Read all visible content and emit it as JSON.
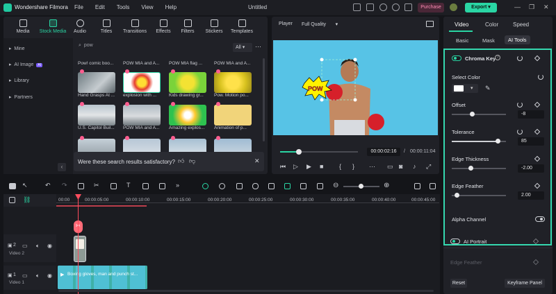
{
  "titlebar": {
    "app_name": "Wondershare Filmora",
    "menu": [
      "File",
      "Edit",
      "Tools",
      "View",
      "Help"
    ],
    "document_title": "Untitled",
    "purchase_label": "Purchase",
    "export_label": "Export"
  },
  "media": {
    "tabs": [
      "Media",
      "Stock Media",
      "Audio",
      "Titles",
      "Transitions",
      "Effects",
      "Filters",
      "Stickers",
      "Templates"
    ],
    "active_tab": "Stock Media",
    "sidebar": [
      "Mine",
      "AI Image",
      "Library",
      "Partners"
    ],
    "ai_badge": "AI",
    "search_value": "pow",
    "filter_value": "All",
    "thumbnails": [
      {
        "caption": "Hand Grasps At ..."
      },
      {
        "caption": "explosion with ..."
      },
      {
        "caption": "Kids drawing gr..."
      },
      {
        "caption": "Pow. Motion po..."
      },
      {
        "caption": "U.S. Capitol Buil..."
      },
      {
        "caption": "POW MIA and A..."
      },
      {
        "caption": "Amazing explos..."
      },
      {
        "caption": "Animation of p..."
      }
    ],
    "top_row_captions": [
      "Pow! comic boo...",
      "POW MIA and A...",
      "POW MIA flag ...",
      "POW MIA and A..."
    ],
    "feedback_text": "Were these search results satisfactory?"
  },
  "player": {
    "label": "Player",
    "quality": "Full Quality",
    "current_time": "00:00:02:16",
    "total_time": "00:00:11:04",
    "progress": 0.24,
    "pow_text": "POW"
  },
  "right_panel": {
    "tabs": [
      "Video",
      "Color",
      "Speed"
    ],
    "active_tab": "Video",
    "subtabs": [
      "Basic",
      "Mask",
      "AI Tools"
    ],
    "active_subtab": "AI Tools",
    "chroma_key_label": "Chroma Key",
    "select_color_label": "Select Color",
    "selected_color": "#ffffff",
    "offset": {
      "label": "Offset",
      "value": "-8",
      "fraction": 0.38
    },
    "tolerance": {
      "label": "Tolerance",
      "value": "85",
      "fraction": 0.85
    },
    "edge_thickness": {
      "label": "Edge Thickness",
      "value": "-2.00",
      "fraction": 0.35
    },
    "edge_feather": {
      "label": "Edge Feather",
      "value": "2.00",
      "fraction": 0.1
    },
    "alpha_channel_label": "Alpha Channel",
    "ai_portrait_label": "AI Portrait",
    "edge_feather_dim_label": "Edge Feather",
    "reset_label": "Reset",
    "keyframe_label": "Keyframe Panel"
  },
  "timeline": {
    "ruler": [
      "00:00",
      "00:00:05:00",
      "00:00:10:00",
      "00:00:15:00",
      "00:00:20:00",
      "00:00:25:00",
      "00:00:30:00",
      "00:00:35:00",
      "00:00:40:00",
      "00:00:45:00"
    ],
    "track2_label": "Video 2",
    "track1_label": "Video 1",
    "track2_index": "2",
    "track1_index": "1",
    "clip1_title": "Boxing gloves, man and punch st..."
  },
  "colors": {
    "accent": "#2ad6a4",
    "highlight_border": "#35d9b0",
    "playhead": "#ff4d5e",
    "screen_bg": "#57c3e6"
  }
}
